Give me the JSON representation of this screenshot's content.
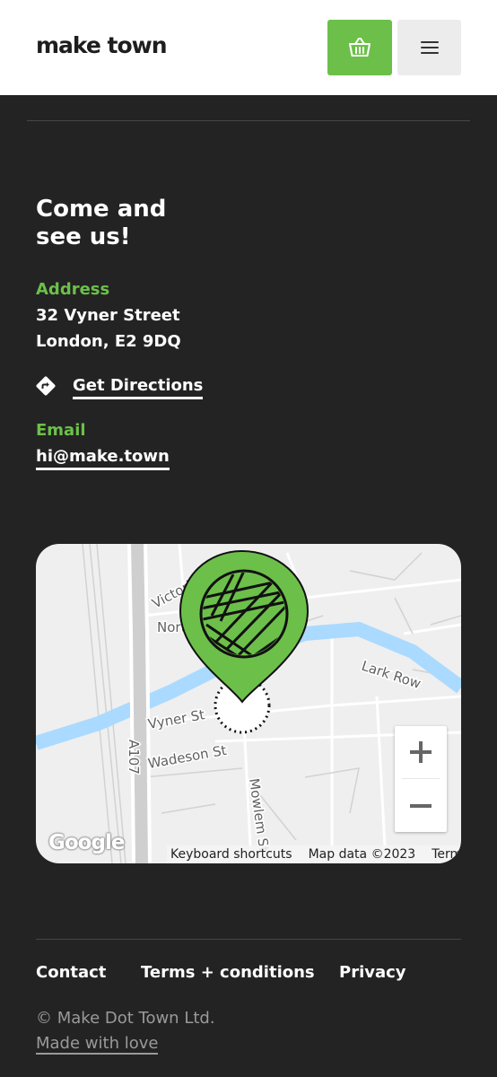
{
  "header": {
    "logo": "make town",
    "basket_icon": "basket-icon",
    "menu_icon": "hamburger-menu-icon",
    "accent_color": "#6cc04a"
  },
  "contact": {
    "heading_line1": "Come and",
    "heading_line2": "see us!",
    "address_label": "Address",
    "address_line1": "32 Vyner Street",
    "address_line2": "London, E2 9DQ",
    "directions_icon": "directions-icon",
    "directions_label": "Get Directions",
    "email_label": "Email",
    "email_value": "hi@make.town"
  },
  "map": {
    "streets": {
      "victoria": "Victoria Rd",
      "north": "North",
      "lark_row": "Lark Row",
      "vyner": "Vyner St",
      "a107": "A107",
      "wadeson": "Wadeson St",
      "mowlem": "Mowlem St"
    },
    "marker_icon": "yarn-ball-map-pin-icon",
    "zoom_in": "+",
    "zoom_out": "−",
    "google_logo": "Google",
    "keyboard_shortcuts": "Keyboard shortcuts",
    "map_data": "Map data ©2023",
    "terms": "Terms"
  },
  "footer": {
    "links": [
      "Contact",
      "Terms + conditions",
      "Privacy"
    ],
    "copyright": "© Make Dot Town Ltd.",
    "made_with_love": "Made with love"
  }
}
